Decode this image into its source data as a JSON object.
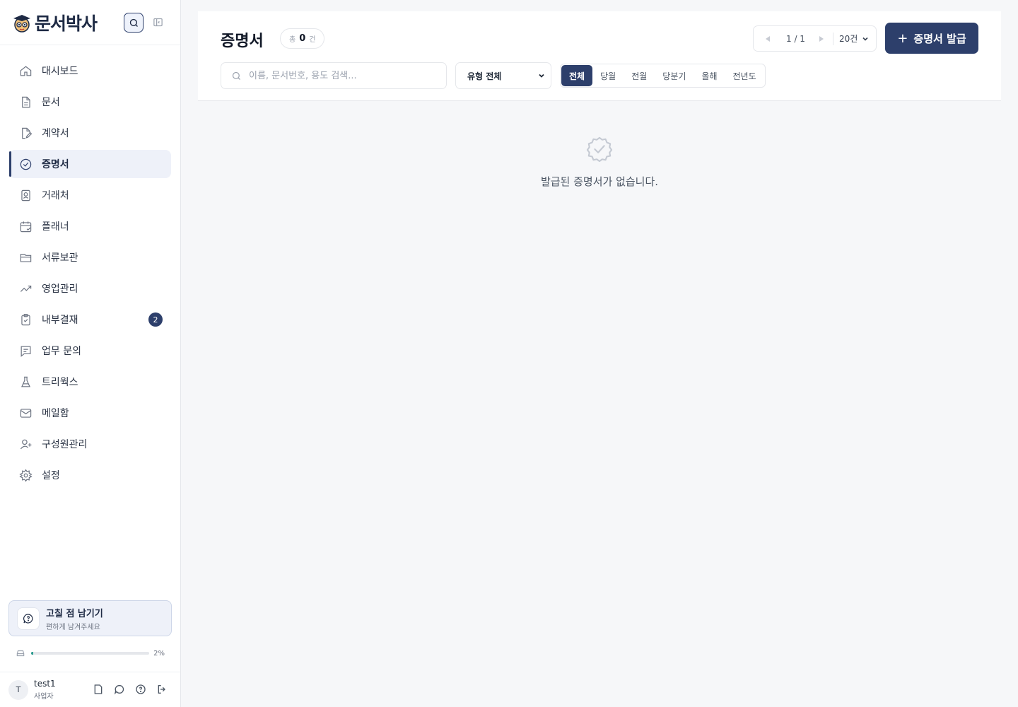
{
  "brand": {
    "name": "문서박사"
  },
  "sidebar": {
    "items": [
      {
        "label": "대시보드",
        "icon": "home-icon"
      },
      {
        "label": "문서",
        "icon": "document-icon"
      },
      {
        "label": "계약서",
        "icon": "contract-icon"
      },
      {
        "label": "증명서",
        "icon": "certificate-icon",
        "active": true
      },
      {
        "label": "거래처",
        "icon": "contact-card-icon"
      },
      {
        "label": "플래너",
        "icon": "calendar-icon"
      },
      {
        "label": "서류보관",
        "icon": "folder-icon"
      },
      {
        "label": "영업관리",
        "icon": "trend-icon"
      },
      {
        "label": "내부결재",
        "icon": "clipboard-check-icon",
        "badge": "2"
      },
      {
        "label": "업무 문의",
        "icon": "message-icon"
      },
      {
        "label": "트리웍스",
        "icon": "flask-icon"
      },
      {
        "label": "메일함",
        "icon": "mail-icon"
      },
      {
        "label": "구성원관리",
        "icon": "user-add-icon"
      },
      {
        "label": "설정",
        "icon": "gear-icon"
      }
    ]
  },
  "feedback": {
    "title": "고칠 점 남기기",
    "subtitle": "편하게 남겨주세요"
  },
  "storage": {
    "percent_label": "2%",
    "percent": 2
  },
  "user": {
    "initial": "T",
    "name": "test1",
    "role": "사업자"
  },
  "header": {
    "title": "증명서",
    "count_prefix": "총",
    "count": "0",
    "count_suffix": "건",
    "page_info": "1 / 1",
    "per_page": "20건",
    "issue_button": "증명서 발급"
  },
  "filters": {
    "search_placeholder": "이름, 문서번호, 용도 검색...",
    "type_select": "유형 전체",
    "periods": [
      "전체",
      "당월",
      "전월",
      "당분기",
      "올해",
      "전년도"
    ],
    "active_period": 0
  },
  "empty_state": {
    "message": "발급된 증명서가 없습니다."
  },
  "colors": {
    "accent": "#2d3f6b",
    "storage_fill": "#2d9c8f",
    "badge": "#2d3f6b"
  }
}
